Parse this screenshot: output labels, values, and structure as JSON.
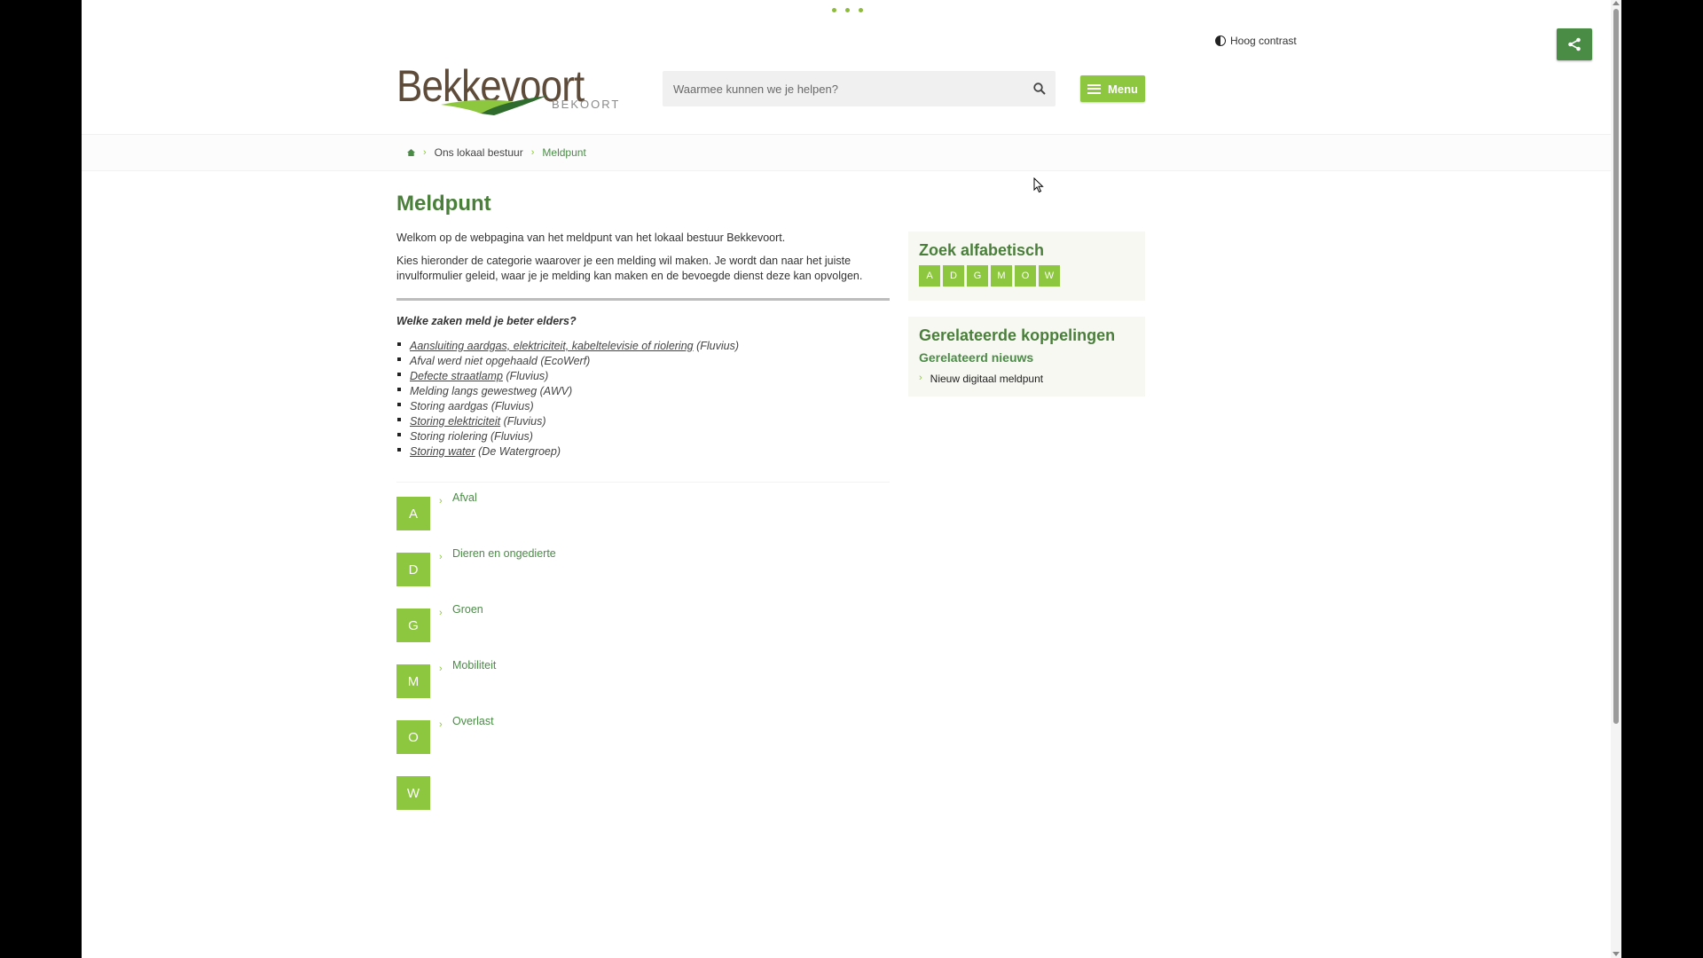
{
  "header": {
    "contrast_label": "Hoog contrast",
    "logo_text": "Bekkevoort",
    "logo_subtext": "BEKOORT",
    "search_placeholder": "Waarmee kunnen we je helpen?",
    "menu_label": "Menu"
  },
  "breadcrumb": {
    "items": [
      "Ons lokaal bestuur",
      "Meldpunt"
    ]
  },
  "main": {
    "title": "Meldpunt",
    "intro": [
      "Welkom op de webpagina van het meldpunt van het lokaal bestuur Bekkevoort.",
      "Kies hieronder de categorie waarover je een melding wil maken. Je wordt dan naar het juiste invulformulier geleid, waar je je melding kan maken en de bevoegde dienst deze kan opvolgen."
    ],
    "elsewhere_heading": "Welke zaken meld je beter elders?",
    "elsewhere_items": [
      {
        "link": "Aansluiting aardgas, elektriciteit, kabeltelevisie of riolering",
        "note": " (Fluvius)"
      },
      {
        "link": "",
        "note": "Afval werd niet opgehaald (EcoWerf)"
      },
      {
        "link": "Defecte straatlamp",
        "note": " (Fluvius)"
      },
      {
        "link": "",
        "note": "Melding langs gewestweg (AWV)"
      },
      {
        "link": "",
        "note": "Storing aardgas (Fluvius)"
      },
      {
        "link": "Storing elektriciteit",
        "note": " (Fluvius)"
      },
      {
        "link": "",
        "note": "Storing riolering (Fluvius)"
      },
      {
        "link": "Storing water",
        "note": " (De Watergroep)"
      }
    ],
    "categories": [
      {
        "letter": "A",
        "label": "Afval"
      },
      {
        "letter": "D",
        "label": "Dieren en ongedierte"
      },
      {
        "letter": "G",
        "label": "Groen"
      },
      {
        "letter": "M",
        "label": "Mobiliteit"
      },
      {
        "letter": "O",
        "label": "Overlast"
      },
      {
        "letter": "W",
        "label": ""
      }
    ]
  },
  "sidebar": {
    "alpha_title": "Zoek alfabetisch",
    "alpha_letters": [
      "A",
      "D",
      "G",
      "M",
      "O",
      "W"
    ],
    "links_title": "Gerelateerde koppelingen",
    "news_title": "Gerelateerd nieuws",
    "news_items": [
      "Nieuw digitaal meldpunt"
    ]
  },
  "colors": {
    "brand_green": "#4a7f3b",
    "accent_lime": "#8dc63f",
    "share_green": "#4a8c46"
  }
}
